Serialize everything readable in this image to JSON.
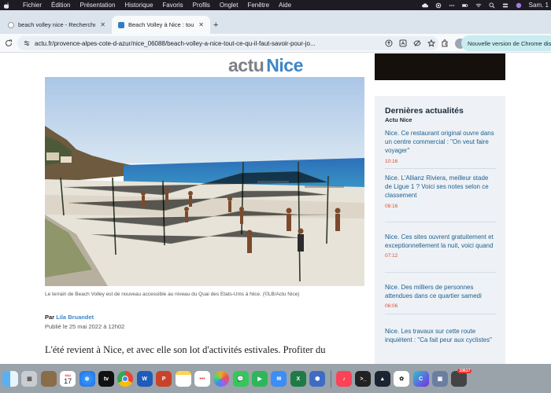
{
  "menubar": {
    "items": [
      "Fichier",
      "Édition",
      "Présentation",
      "Historique",
      "Favoris",
      "Profils",
      "Onglet",
      "Fenêtre",
      "Aide"
    ],
    "clock": "Sam. 1"
  },
  "tabs": [
    {
      "title": "beach volley nice - Recherche",
      "active": false
    },
    {
      "title": "Beach Volley à Nice : tout ce",
      "active": true
    }
  ],
  "toolbar": {
    "url": "actu.fr/provence-alpes-cote-d-azur/nice_06088/beach-volley-a-nice-tout-ce-qu-il-faut-savoir-pour-jo...",
    "update_label": "Nouvelle version de Chrome dis"
  },
  "site": {
    "logo_actu": "actu",
    "logo_city": "Nice"
  },
  "article": {
    "caption": "Le terrain de Beach Volley est de nouveau accessible au niveau du Quai des Etats-Unis à Nice. (©LB/Actu Nice)",
    "by_prefix": "Par",
    "author": "Lila Bruandet",
    "published": "Publié le 25 mai 2022 à 12h02",
    "lead": "L'été revient à Nice, et avec elle son lot d'activités estivales. Profiter du"
  },
  "sidebar": {
    "title": "Dernières actualités",
    "subtitle": "Actu Nice",
    "items": [
      {
        "text": "Nice. Ce restaurant original ouvre dans un centre commercial : \"On veut faire voyager\"",
        "time": "10:16"
      },
      {
        "text": "Nice. L'Allianz Riviera, meilleur stade de Ligue 1 ? Voici ses notes selon ce classement",
        "time": "08:16"
      },
      {
        "text": "Nice. Ces sites ouvrent gratuitement et exceptionnellement la nuit, voici quand",
        "time": "07:12"
      },
      {
        "text": "Nice. Des milliers de personnes attendues dans ce quartier samedi",
        "time": "06:06"
      },
      {
        "text": "Nice. Les travaux sur cette route inquiètent : \"Ca fait peur aux cyclistes\"",
        "time": ""
      }
    ]
  },
  "dock": {
    "calendar_month": "MAI",
    "calendar_day": "17",
    "badge": "10617",
    "apps": [
      "finder-icon",
      "launchpad-icon",
      "notes-folder-icon",
      "calendar-icon",
      "safari-icon",
      "appletv-icon",
      "chrome-icon",
      "word-icon",
      "powerpoint-icon",
      "notes-icon",
      "reminders-icon",
      "photos-icon",
      "messages-icon",
      "facetime-icon",
      "mail-icon",
      "excel-icon",
      "shield-icon",
      "music-icon",
      "terminal-icon",
      "prime-icon",
      "chatgpt-icon",
      "canva-icon",
      "preview-icon",
      "calculator-icon"
    ]
  }
}
